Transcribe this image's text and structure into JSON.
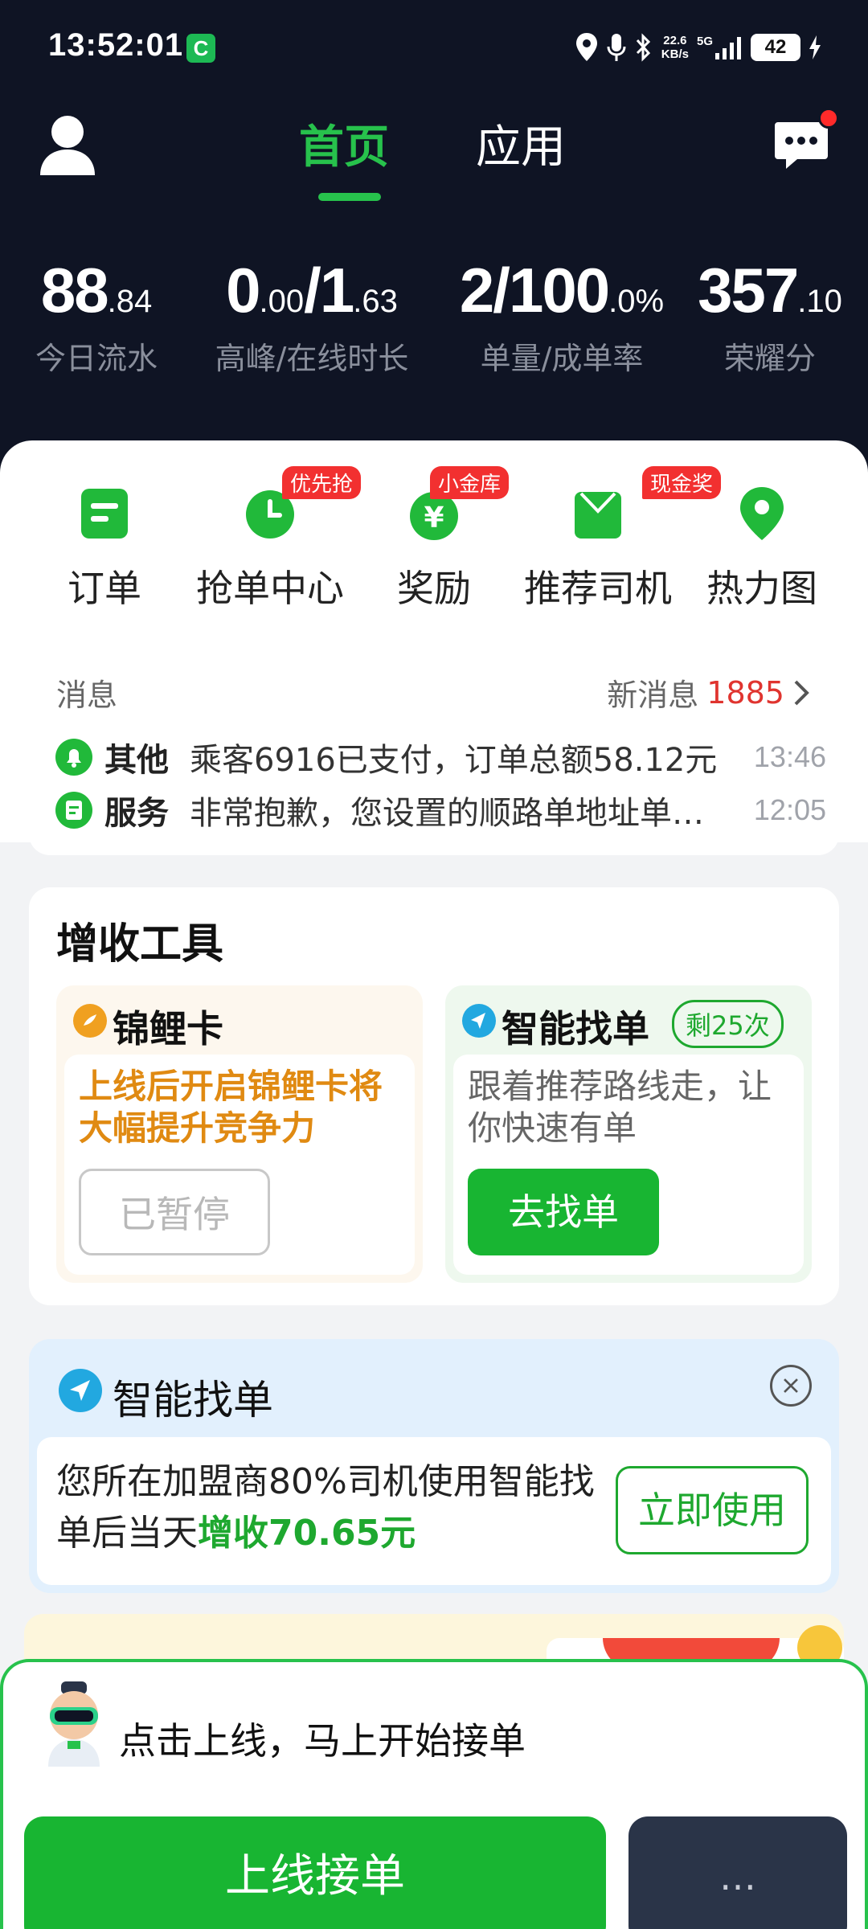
{
  "status_bar": {
    "time": "13:52:01",
    "carrier_badge": "C",
    "speed_value": "22.6",
    "speed_unit": "KB/s",
    "network": "5G",
    "battery": "42"
  },
  "nav": {
    "tab_home": "首页",
    "tab_apps": "应用"
  },
  "stats": [
    {
      "main": "88",
      "decimal": ".84",
      "label": "今日流水"
    },
    {
      "main": "0",
      "decimal": ".00",
      "main2": "/1",
      "decimal2": ".63",
      "label": "高峰/在线时长"
    },
    {
      "main": "2/100",
      "decimal": ".0%",
      "label": "单量/成单率"
    },
    {
      "main": "357",
      "decimal": ".10",
      "label": "荣耀分"
    }
  ],
  "quick_actions": [
    {
      "label": "订单",
      "tag": "",
      "icon": "order-icon"
    },
    {
      "label": "抢单中心",
      "tag": "优先抢",
      "icon": "grab-order-icon"
    },
    {
      "label": "奖励",
      "tag": "小金库",
      "icon": "reward-icon"
    },
    {
      "label": "推荐司机",
      "tag": "现金奖",
      "icon": "recommend-driver-icon"
    },
    {
      "label": "热力图",
      "tag": "",
      "icon": "location-pin-icon"
    }
  ],
  "messages": {
    "title": "消息",
    "new_label": "新消息",
    "new_count": "1885",
    "rows": [
      {
        "category": "其他",
        "text": "乘客6916已支付，订单总额58.12元",
        "time": "13:46",
        "icon": "bell-icon"
      },
      {
        "category": "服务",
        "text": "非常抱歉，您设置的顺路单地址单…",
        "time": "12:05",
        "icon": "service-icon"
      }
    ]
  },
  "tools": {
    "title": "增收工具",
    "koi": {
      "title": "锦鲤卡",
      "desc": "上线后开启锦鲤卡将大幅提升竞争力",
      "button": "已暂停"
    },
    "smart": {
      "title": "智能找单",
      "remaining": "剩25次",
      "desc": "跟着推荐路线走，让你快速有单",
      "button": "去找单"
    }
  },
  "smart_banner": {
    "title": "智能找单",
    "desc_prefix": "您所在加盟商80%司机使用智能找单后当天",
    "desc_highlight": "增收70.65元",
    "button": "立即使用"
  },
  "bottom": {
    "hint": "点击上线，马上开始接单",
    "go_online": "上线接单",
    "side_button": "…"
  },
  "colors": {
    "accent": "#27c24c",
    "dark_bg": "#0f1424",
    "alert_red": "#f23030",
    "koi_orange": "#e08a12"
  }
}
